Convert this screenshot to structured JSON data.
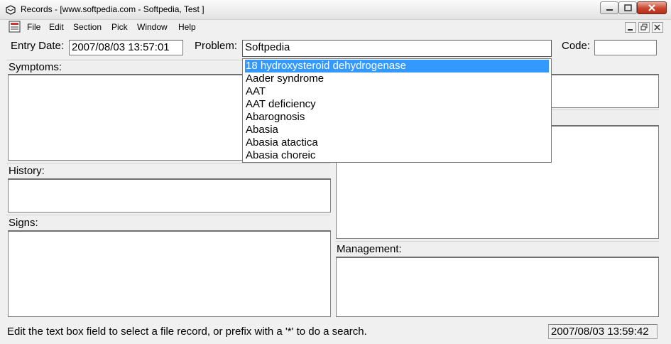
{
  "window": {
    "title": "Records - [www.softpedia.com - Softpedia, Test ]",
    "controls": {
      "minimize_icon": "minimize-icon",
      "maximize_icon": "maximize-icon",
      "close_icon": "close-icon"
    }
  },
  "menu": {
    "items": [
      "File",
      "Edit",
      "Section",
      "Pick",
      "Window",
      "Help"
    ]
  },
  "form": {
    "entry_date_label": "Entry Date:",
    "entry_date_value": "2007/08/03 13:57:01",
    "problem_label": "Problem:",
    "problem_value": "Softpedia",
    "code_label": "Code:",
    "code_value": "",
    "symptoms_label": "Symptoms:",
    "history_label": "History:",
    "signs_label": "Signs:",
    "management_label": "Management:"
  },
  "dropdown": {
    "selected_index": 0,
    "items": [
      "18 hydroxysteroid dehydrogenase",
      "Aader syndrome",
      "AAT",
      "AAT deficiency",
      "Abarognosis",
      "Abasia",
      "Abasia atactica",
      "Abasia choreic"
    ]
  },
  "status": {
    "message": "Edit the text box field to select a file record, or prefix with a '*' to do a search.",
    "timestamp": "2007/08/03 13:59:42"
  },
  "colors": {
    "selection": "#3399ff",
    "close_button": "#c8452f"
  }
}
